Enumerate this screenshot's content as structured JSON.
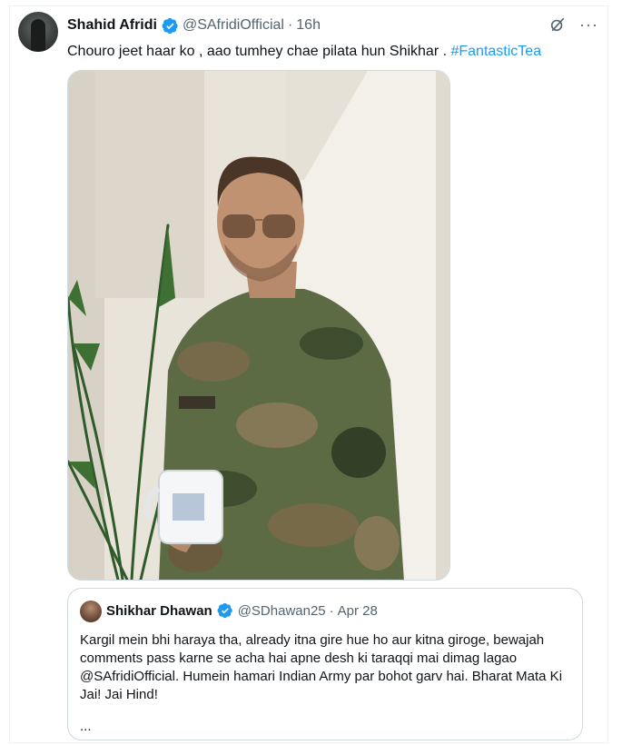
{
  "tweet": {
    "author_name": "Shahid Afridi",
    "handle": "@SAfridiOfficial",
    "separator": "·",
    "time": "16h",
    "text_main": "Chouro jeet haar ko , aao tumhey chae pilata hun Shikhar . ",
    "hashtag": "#FantasticTea",
    "icons": {
      "verified": "verified-badge-icon",
      "grok": "grok-icon",
      "more": "more-options-icon"
    },
    "more_glyph": "···"
  },
  "quoted_tweet": {
    "author_name": "Shikhar Dhawan",
    "handle": "@SDhawan25",
    "separator": "·",
    "date": "Apr 28",
    "text": "Kargil mein bhi haraya tha, already itna gire hue ho aur kitna giroge, bewajah comments pass karne se acha hai apne desh ki taraqqi mai dimag lagao @SAfridiOfficial. Humein hamari Indian Army par bohot garv hai. Bharat Mata Ki Jai! Jai Hind!",
    "truncation": "..."
  },
  "colors": {
    "text_primary": "#0f1419",
    "text_secondary": "#536471",
    "link": "#1d9bf0",
    "border": "#cfd9de"
  }
}
